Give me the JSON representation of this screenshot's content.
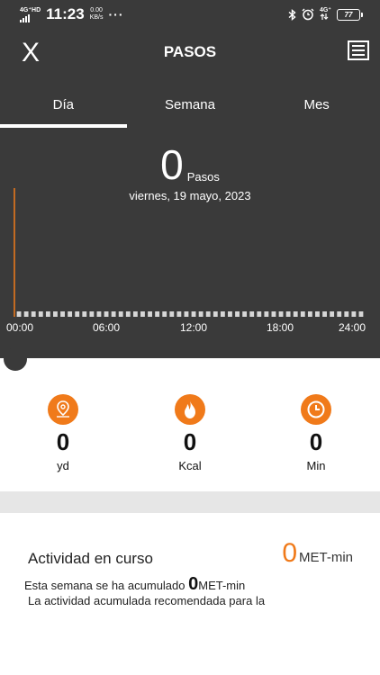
{
  "status_bar": {
    "network": "4G⁺HD",
    "time": "11:23",
    "speed_value": "0.00",
    "speed_unit": "KB/s",
    "more": "···",
    "net_right": "4G⁺",
    "battery": "77"
  },
  "header": {
    "close_label": "X",
    "title": "PASOS"
  },
  "tabs": [
    {
      "label": "Día",
      "active": true
    },
    {
      "label": "Semana",
      "active": false
    },
    {
      "label": "Mes",
      "active": false
    }
  ],
  "summary": {
    "steps": "0",
    "steps_unit": "Pasos",
    "date": "viernes, 19 mayo, 2023"
  },
  "chart_data": {
    "type": "bar",
    "x_tick_labels": [
      "00:00",
      "06:00",
      "12:00",
      "18:00",
      "24:00"
    ],
    "bins": 48,
    "values": [
      0,
      0,
      0,
      0,
      0,
      0,
      0,
      0,
      0,
      0,
      0,
      0,
      0,
      0,
      0,
      0,
      0,
      0,
      0,
      0,
      0,
      0,
      0,
      0,
      0,
      0,
      0,
      0,
      0,
      0,
      0,
      0,
      0,
      0,
      0,
      0,
      0,
      0,
      0,
      0,
      0,
      0,
      0,
      0,
      0,
      0,
      0,
      0
    ],
    "cursor_color": "#f07a1a"
  },
  "stats": [
    {
      "icon": "location-pin-icon",
      "value": "0",
      "unit": "yd"
    },
    {
      "icon": "flame-icon",
      "value": "0",
      "unit": "Kcal"
    },
    {
      "icon": "clock-icon",
      "value": "0",
      "unit": "Min"
    }
  ],
  "activity": {
    "title": "Actividad en curso",
    "met_value": "0",
    "met_unit": "MET-min",
    "week_prefix": "Esta semana se ha acumulado",
    "week_value": "0",
    "week_unit": "MET-min",
    "recommendation": "La actividad acumulada recomendada para la"
  },
  "colors": {
    "accent": "#f07a1a",
    "header_bg": "#3a3a3a"
  }
}
